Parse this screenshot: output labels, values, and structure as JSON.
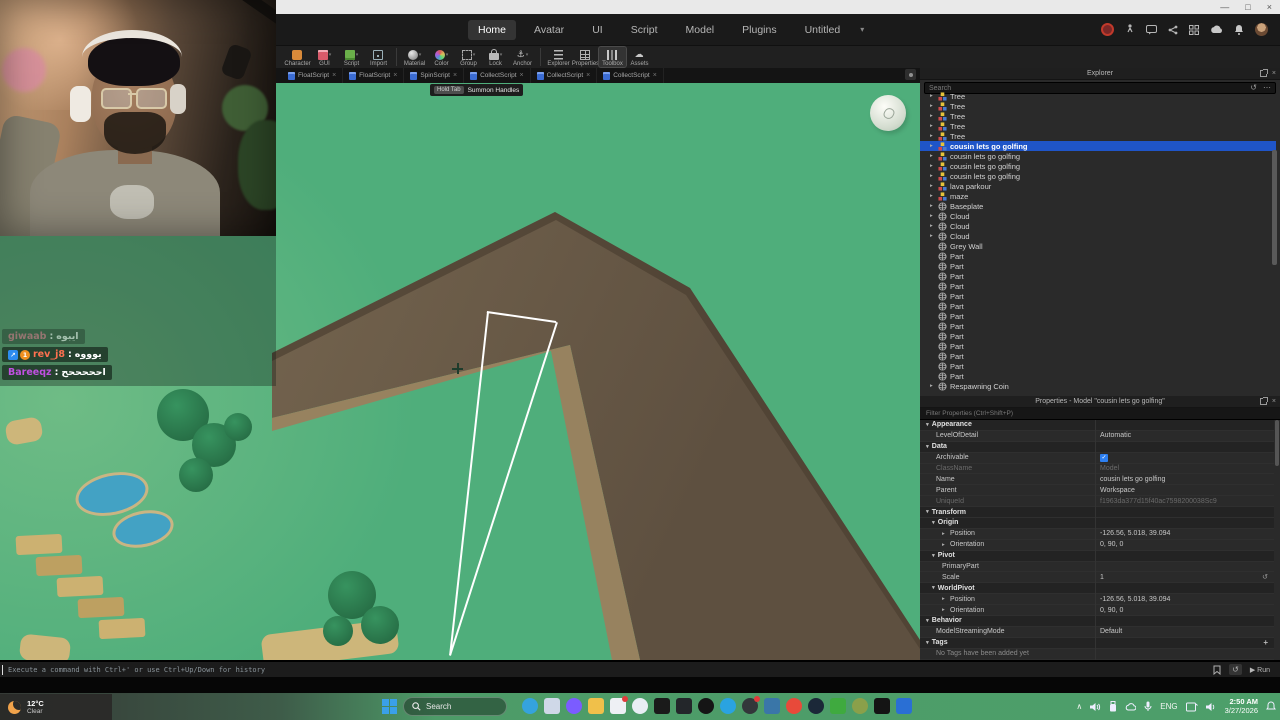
{
  "window": {
    "minimize_glyph": "—",
    "maximize_glyph": "□",
    "close_glyph": "×"
  },
  "glyphs": {
    "close": "×",
    "caret": "▾",
    "expand_open": "▾",
    "expand_closed": "▸",
    "history": "↺",
    "ellipsis": "⋯",
    "check": "✓",
    "plus": "+",
    "reset": "↺",
    "run": "▶",
    "chevron_up": "∧",
    "anchor": "⚓",
    "cloud": "☁"
  },
  "menu": {
    "tabs": [
      {
        "label": "Home",
        "active": true
      },
      {
        "label": "Avatar"
      },
      {
        "label": "UI"
      },
      {
        "label": "Script"
      },
      {
        "label": "Model"
      },
      {
        "label": "Plugins"
      },
      {
        "label": "Untitled"
      }
    ],
    "overflow_caret": "▾",
    "right_icons": [
      "record",
      "walk",
      "chat",
      "share",
      "grid",
      "cloud",
      "notifications",
      "avatar"
    ]
  },
  "ribbon": {
    "buttons": [
      {
        "label": "Character",
        "icon": "character"
      },
      {
        "label": "GUI",
        "icon": "gui",
        "caret": true
      },
      {
        "label": "Script",
        "icon": "script",
        "caret": true
      },
      {
        "label": "Import",
        "icon": "import"
      },
      {
        "sep": true
      },
      {
        "label": "Material",
        "icon": "material",
        "caret": true
      },
      {
        "label": "Color",
        "icon": "color",
        "caret": true
      },
      {
        "label": "Group",
        "icon": "group",
        "caret": true
      },
      {
        "label": "Lock",
        "icon": "lock",
        "caret": true
      },
      {
        "label": "Anchor",
        "icon": "anchor",
        "caret": true
      },
      {
        "sep": true
      },
      {
        "label": "Explorer",
        "icon": "explorer"
      },
      {
        "label": "Properties",
        "icon": "properties"
      },
      {
        "label": "Toolbox",
        "icon": "toolbox",
        "active": true
      },
      {
        "label": "Assets",
        "icon": "assets"
      }
    ]
  },
  "script_tabs": [
    {
      "label": "FloatScript"
    },
    {
      "label": "FloatScript"
    },
    {
      "label": "SpinScript"
    },
    {
      "label": "CollectScript"
    },
    {
      "label": "CollectScript"
    },
    {
      "label": "CollectScript"
    }
  ],
  "viewport": {
    "tooltip_key": "Hold Tab",
    "tooltip_label": "Summon Handles"
  },
  "overlay_chat": {
    "separator": " : ",
    "messages": [
      {
        "user": "giwaab",
        "user_color": "#e06a86",
        "text": "ايبوه",
        "faded": true,
        "badges": []
      },
      {
        "user": "rev_j8",
        "user_color": "#ff7150",
        "text": "يوووه",
        "faded": false,
        "badges": [
          {
            "type": "sub",
            "glyph": "↗",
            "color": "#2d8cf0",
            "shape": "square"
          },
          {
            "type": "gift",
            "glyph": "1",
            "color": "#f09020",
            "shape": "circle"
          }
        ]
      },
      {
        "user": "Bareeqz",
        "user_color": "#c050e0",
        "text": "احححححح",
        "faded": false,
        "badges": []
      }
    ]
  },
  "explorer": {
    "title": "Explorer",
    "search_placeholder": "Search",
    "items": [
      {
        "label": "Tree",
        "icon": "model",
        "arrow": true,
        "partial": true
      },
      {
        "label": "Tree",
        "icon": "model",
        "arrow": true
      },
      {
        "label": "Tree",
        "icon": "model",
        "arrow": true
      },
      {
        "label": "Tree",
        "icon": "model",
        "arrow": true
      },
      {
        "label": "Tree",
        "icon": "model",
        "arrow": true
      },
      {
        "label": "cousin lets go golfing",
        "icon": "model",
        "arrow": true,
        "selected": true
      },
      {
        "label": "cousin lets go golfing",
        "icon": "model",
        "arrow": true
      },
      {
        "label": "cousin lets go golfing",
        "icon": "model",
        "arrow": true
      },
      {
        "label": "cousin lets go golfing",
        "icon": "model",
        "arrow": true
      },
      {
        "label": "lava parkour",
        "icon": "model",
        "arrow": true
      },
      {
        "label": "maze",
        "icon": "model",
        "arrow": true
      },
      {
        "label": "Baseplate",
        "icon": "part",
        "arrow": true
      },
      {
        "label": "Cloud",
        "icon": "part",
        "arrow": true
      },
      {
        "label": "Cloud",
        "icon": "part",
        "arrow": true
      },
      {
        "label": "Cloud",
        "icon": "part",
        "arrow": true
      },
      {
        "label": "Grey Wall",
        "icon": "part",
        "arrow": false
      },
      {
        "label": "Part",
        "icon": "part",
        "arrow": false
      },
      {
        "label": "Part",
        "icon": "part",
        "arrow": false
      },
      {
        "label": "Part",
        "icon": "part",
        "arrow": false
      },
      {
        "label": "Part",
        "icon": "part",
        "arrow": false
      },
      {
        "label": "Part",
        "icon": "part",
        "arrow": false
      },
      {
        "label": "Part",
        "icon": "part",
        "arrow": false
      },
      {
        "label": "Part",
        "icon": "part",
        "arrow": false
      },
      {
        "label": "Part",
        "icon": "part",
        "arrow": false
      },
      {
        "label": "Part",
        "icon": "part",
        "arrow": false
      },
      {
        "label": "Part",
        "icon": "part",
        "arrow": false
      },
      {
        "label": "Part",
        "icon": "part",
        "arrow": false
      },
      {
        "label": "Part",
        "icon": "part",
        "arrow": false
      },
      {
        "label": "Part",
        "icon": "part",
        "arrow": false
      },
      {
        "label": "Respawning Coin",
        "icon": "part",
        "arrow": true
      }
    ]
  },
  "properties": {
    "title": "Properties - Model \"cousin lets go golfing\"",
    "filter_placeholder": "Filter Properties (Ctrl+Shift+P)",
    "rows": [
      {
        "type": "section",
        "label": "Appearance",
        "level": 1
      },
      {
        "type": "row",
        "label": "LevelOfDetail",
        "value": "Automatic",
        "indent": 1
      },
      {
        "type": "section",
        "label": "Data",
        "level": 1
      },
      {
        "type": "row",
        "label": "Archivable",
        "checkbox": true,
        "indent": 1
      },
      {
        "type": "row",
        "label": "ClassName",
        "value": "Model",
        "muted": true,
        "indent": 1
      },
      {
        "type": "row",
        "label": "Name",
        "value": "cousin lets go golfing",
        "indent": 1
      },
      {
        "type": "row",
        "label": "Parent",
        "value": "Workspace",
        "indent": 1
      },
      {
        "type": "row",
        "label": "UniqueId",
        "value": "f1963da377d15f40ac7598200038Sc9",
        "muted": true,
        "indent": 1
      },
      {
        "type": "section",
        "label": "Transform",
        "level": 1
      },
      {
        "type": "section",
        "label": "Origin",
        "level": 2
      },
      {
        "type": "row",
        "label": "Position",
        "value": "-126.56, 5.018, 39.094",
        "arrow": true,
        "indent": 3
      },
      {
        "type": "row",
        "label": "Orientation",
        "value": "0, 90, 0",
        "arrow": true,
        "indent": 3
      },
      {
        "type": "section",
        "label": "Pivot",
        "level": 2
      },
      {
        "type": "row",
        "label": "PrimaryPart",
        "value": "",
        "indent": 2
      },
      {
        "type": "row",
        "label": "Scale",
        "value": "1",
        "reset": true,
        "indent": 2
      },
      {
        "type": "section",
        "label": "WorldPivot",
        "level": 2
      },
      {
        "type": "row",
        "label": "Position",
        "value": "-126.56, 5.018, 39.094",
        "arrow": true,
        "indent": 3
      },
      {
        "type": "row",
        "label": "Orientation",
        "value": "0, 90, 0",
        "arrow": true,
        "indent": 3
      },
      {
        "type": "section",
        "label": "Behavior",
        "level": 1
      },
      {
        "type": "row",
        "label": "ModelStreamingMode",
        "value": "Default",
        "indent": 1
      },
      {
        "type": "section",
        "label": "Tags",
        "level": 1,
        "plus": true
      },
      {
        "type": "note",
        "label": "No Tags have been added yet"
      }
    ]
  },
  "command_bar": {
    "hint": "Execute a command with Ctrl+' or use Ctrl+Up/Down for history",
    "run_label": "Run"
  },
  "taskbar": {
    "weather_temp": "12°C",
    "weather_condition": "Clear",
    "search_label": "Search",
    "language": "ENG",
    "time": "2:50 AM",
    "date": "3/27/2026",
    "apps": [
      {
        "name": "edge",
        "color": "#35a3dd",
        "round": true
      },
      {
        "name": "widgets",
        "color": "#cfd8e8"
      },
      {
        "name": "medal",
        "color": "#7b5cff",
        "round": true
      },
      {
        "name": "file-explorer",
        "color": "#f0c04a"
      },
      {
        "name": "discord",
        "color": "#eef0f4",
        "notify": true
      },
      {
        "name": "browser",
        "color": "#e8eef4",
        "round": true
      },
      {
        "name": "capcut",
        "color": "#1a1a1a"
      },
      {
        "name": "obs",
        "color": "#23262a"
      },
      {
        "name": "xbox",
        "color": "#151515",
        "round": true
      },
      {
        "name": "telegram",
        "color": "#2aa3e0",
        "round": true
      },
      {
        "name": "opera-gx",
        "color": "#33363a",
        "round": true,
        "notify": true
      },
      {
        "name": "python",
        "color": "#3a76a8"
      },
      {
        "name": "brave",
        "color": "#e84a3a",
        "round": true
      },
      {
        "name": "steam",
        "color": "#1b2838",
        "round": true
      },
      {
        "name": "minecraft",
        "color": "#3faa3f"
      },
      {
        "name": "quik",
        "color": "#8aa04a",
        "round": true
      },
      {
        "name": "notepad",
        "color": "#141414"
      },
      {
        "name": "vscode",
        "color": "#2a6fd4"
      }
    ]
  }
}
